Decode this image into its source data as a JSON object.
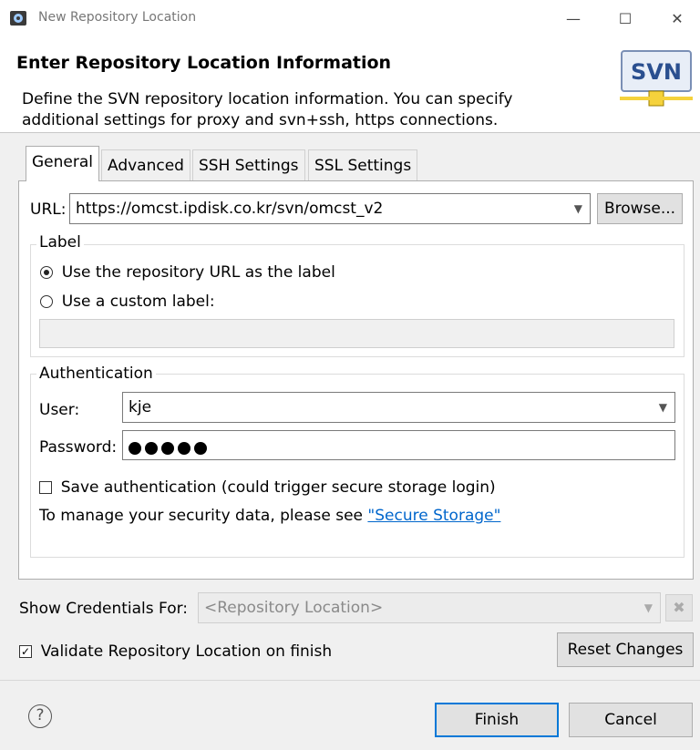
{
  "window": {
    "title": "New Repository Location",
    "minimize_glyph": "—",
    "maximize_glyph": "☐",
    "close_glyph": "✕"
  },
  "header": {
    "title": "Enter Repository Location Information",
    "description_line1": "Define the SVN repository location information. You can specify",
    "description_line2": "additional settings for proxy and svn+ssh, https connections.",
    "logo_text": "SVN"
  },
  "tabs": [
    {
      "label": "General",
      "active": true
    },
    {
      "label": "Advanced",
      "active": false
    },
    {
      "label": "SSH Settings",
      "active": false
    },
    {
      "label": "SSL Settings",
      "active": false
    }
  ],
  "general": {
    "url_label": "URL:",
    "url_value": "https://omcst.ipdisk.co.kr/svn/omcst_v2",
    "browse_label": "Browse...",
    "label_group": {
      "title": "Label",
      "option_repo_url": "Use the repository URL as the label",
      "option_custom": "Use a custom label:",
      "custom_value": ""
    },
    "auth_group": {
      "title": "Authentication",
      "user_label": "User:",
      "user_value": "kje",
      "password_label": "Password:",
      "password_length": 5,
      "save_auth_label": "Save authentication (could trigger secure storage login)",
      "save_auth_checked": false,
      "manage_text": "To manage your security data, please see ",
      "secure_storage_link": "\"Secure Storage\""
    }
  },
  "credentials": {
    "label": "Show Credentials For:",
    "value": "<Repository Location>"
  },
  "validate": {
    "label": "Validate Repository Location on finish",
    "checked": true
  },
  "buttons": {
    "reset": "Reset Changes",
    "finish": "Finish",
    "cancel": "Cancel",
    "help": "?"
  },
  "colors": {
    "link": "#0066cc",
    "finish_border": "#0078d7",
    "svn_blue": "#2a4f8f"
  }
}
